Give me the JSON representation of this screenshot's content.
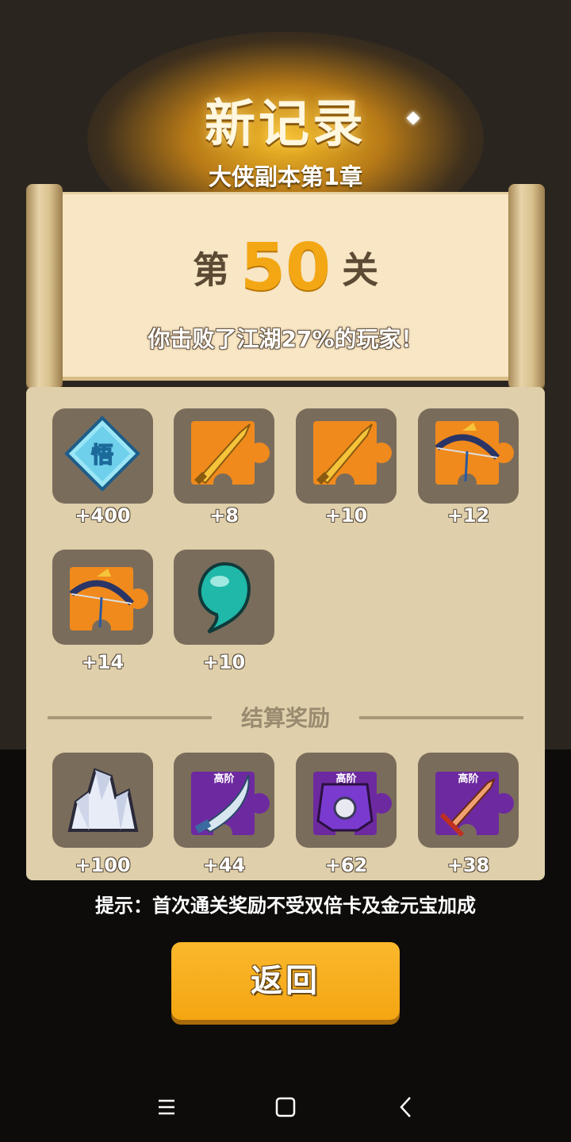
{
  "header": {
    "title": "新记录",
    "subtitle": "大侠副本第1章"
  },
  "scroll": {
    "level_prefix": "第",
    "level_number": "50",
    "level_suffix": "关",
    "beat_text": "你击败了江湖27%的玩家！"
  },
  "first_rewards": [
    {
      "icon": "wu-enlightenment-icon",
      "amount": "+400"
    },
    {
      "icon": "golden-sword-fragment-icon",
      "amount": "+8"
    },
    {
      "icon": "golden-sword-fragment-icon",
      "amount": "+10"
    },
    {
      "icon": "dark-bow-fragment-icon",
      "amount": "+12"
    },
    {
      "icon": "dark-bow-fragment-icon",
      "amount": "+14"
    },
    {
      "icon": "teal-jade-orb-icon",
      "amount": "+10"
    }
  ],
  "settlement": {
    "title": "结算奖励",
    "tier_label": "高阶",
    "items": [
      {
        "icon": "crystal-ore-icon",
        "amount": "+100"
      },
      {
        "icon": "purple-sabre-fragment-icon",
        "amount": "+44"
      },
      {
        "icon": "purple-armor-fragment-icon",
        "amount": "+62"
      },
      {
        "icon": "purple-sword-fragment-icon",
        "amount": "+38"
      }
    ]
  },
  "hint": "提示：首次通关奖励不受双倍卡及金元宝加成",
  "back_button": "返回",
  "colors": {
    "accent_orange": "#f3a714",
    "panel": "#dfcfaa",
    "slot": "#7a6c5b",
    "fragment_orange": "#f08a1c",
    "fragment_purple": "#6d2aa0"
  }
}
